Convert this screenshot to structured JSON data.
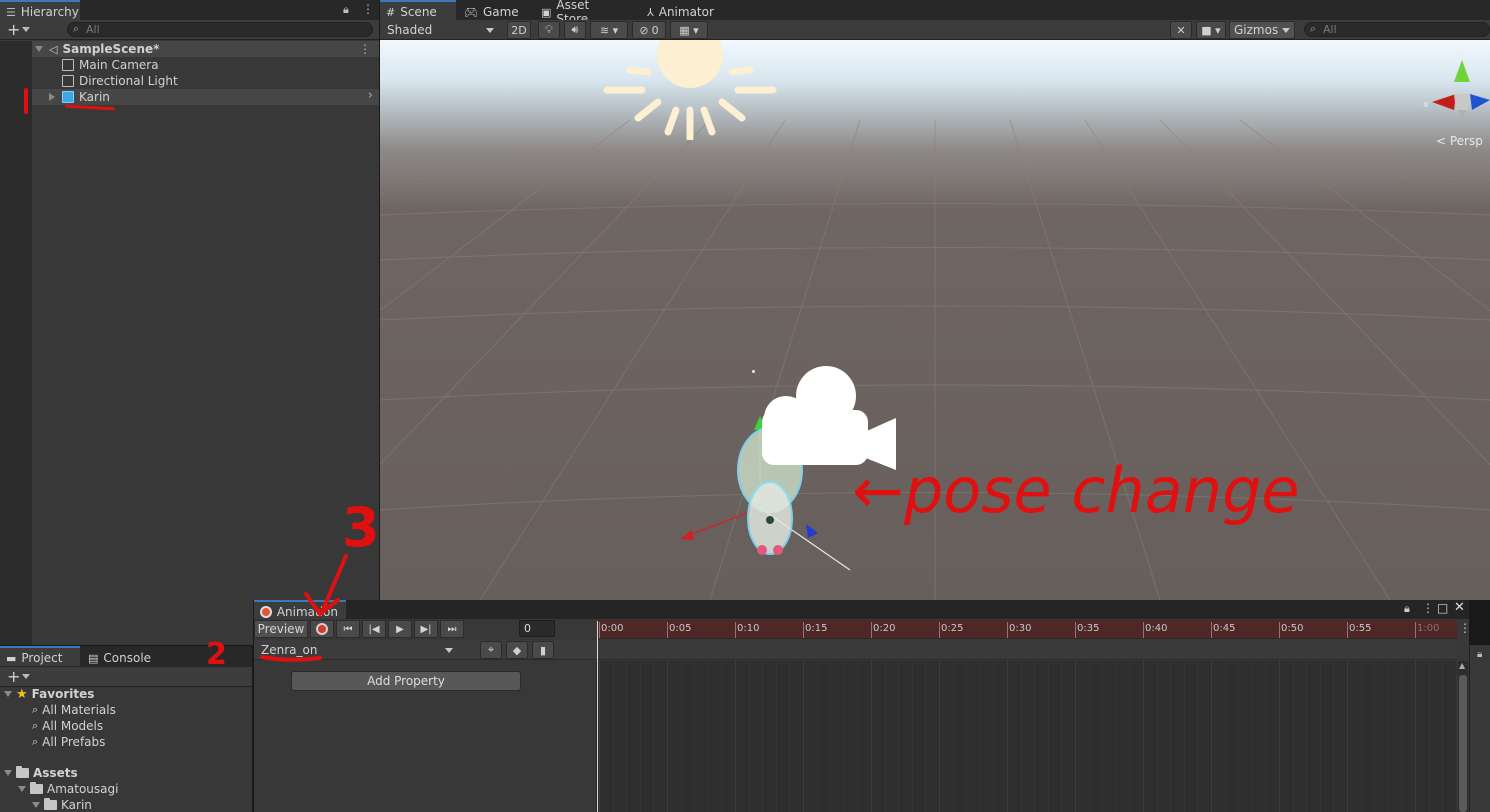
{
  "hierarchy": {
    "tab_label": "Hierarchy",
    "search_placeholder": "All",
    "scene_name": "SampleScene*",
    "items": [
      {
        "label": "Main Camera"
      },
      {
        "label": "Directional Light"
      },
      {
        "label": "Karin"
      }
    ]
  },
  "scene": {
    "tabs": [
      {
        "label": "Scene"
      },
      {
        "label": "Game"
      },
      {
        "label": "Asset Store"
      },
      {
        "label": "Animator"
      }
    ],
    "shading_mode": "Shaded",
    "mode_2d": "2D",
    "hidden_count": "0",
    "gizmos_label": "Gizmos",
    "search_placeholder": "All",
    "persp_label": "< Persp",
    "axis_y": "y",
    "axis_x": "x",
    "sky_color": "#e8f1fa",
    "ground_color": "#675f5b"
  },
  "project": {
    "tabs": [
      {
        "label": "Project"
      },
      {
        "label": "Console"
      }
    ],
    "favorites_label": "Favorites",
    "favorites": [
      {
        "label": "All Materials"
      },
      {
        "label": "All Models"
      },
      {
        "label": "All Prefabs"
      }
    ],
    "assets_label": "Assets",
    "folders": [
      {
        "label": "Amatousagi"
      },
      {
        "label": "Karin"
      }
    ]
  },
  "animation": {
    "tab_label": "Animation",
    "preview_label": "Preview",
    "frame_value": "0",
    "clip_name": "Zenra_on",
    "add_property_label": "Add Property",
    "ruler": [
      "0:00",
      "0:05",
      "0:10",
      "0:15",
      "0:20",
      "0:25",
      "0:30",
      "0:35",
      "0:40",
      "0:45",
      "0:50",
      "0:55",
      "1:00"
    ]
  },
  "annotations": {
    "label_1": "1",
    "label_2": "2",
    "label_3": "3",
    "pose_text": "←pose change",
    "color": "#e01010"
  }
}
